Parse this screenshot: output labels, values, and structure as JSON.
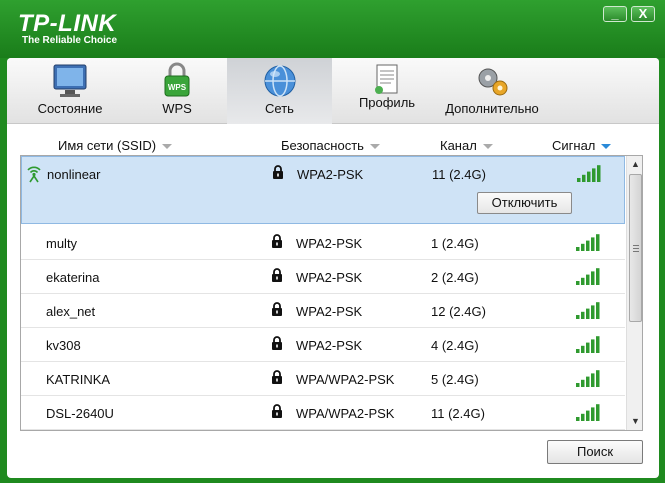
{
  "brand": {
    "name": "TP-LINK",
    "tagline": "The Reliable Choice",
    "accent": "#1f8a1f"
  },
  "window_controls": {
    "minimize": "_",
    "close": "X"
  },
  "tabs": [
    {
      "label": "Состояние",
      "icon": "monitor-icon",
      "active": false
    },
    {
      "label": "WPS",
      "icon": "wps-lock-icon",
      "active": false
    },
    {
      "label": "Сеть",
      "icon": "globe-icon",
      "active": true
    },
    {
      "label": "Профиль",
      "icon": "profile-document-icon",
      "active": false
    },
    {
      "label": "Дополнительно",
      "icon": "gears-icon",
      "active": false
    }
  ],
  "columns": {
    "ssid": "Имя сети (SSID)",
    "security": "Безопасность",
    "channel": "Канал",
    "signal": "Сигнал",
    "sorted_by": "signal"
  },
  "networks": [
    {
      "ssid": "nonlinear",
      "security": "WPA2-PSK",
      "channel": "11 (2.4G)",
      "signal_bars": 5,
      "connected": true
    },
    {
      "ssid": "multy",
      "security": "WPA2-PSK",
      "channel": "1 (2.4G)",
      "signal_bars": 5,
      "connected": false
    },
    {
      "ssid": "ekaterina",
      "security": "WPA2-PSK",
      "channel": "2 (2.4G)",
      "signal_bars": 5,
      "connected": false
    },
    {
      "ssid": "alex_net",
      "security": "WPA2-PSK",
      "channel": "12 (2.4G)",
      "signal_bars": 5,
      "connected": false
    },
    {
      "ssid": "kv308",
      "security": "WPA2-PSK",
      "channel": "4 (2.4G)",
      "signal_bars": 5,
      "connected": false
    },
    {
      "ssid": "KATRINKA",
      "security": "WPA/WPA2-PSK",
      "channel": "5 (2.4G)",
      "signal_bars": 5,
      "connected": false
    },
    {
      "ssid": "DSL-2640U",
      "security": "WPA/WPA2-PSK",
      "channel": "11 (2.4G)",
      "signal_bars": 5,
      "connected": false
    }
  ],
  "actions": {
    "disconnect": "Отключить",
    "search": "Поиск"
  }
}
